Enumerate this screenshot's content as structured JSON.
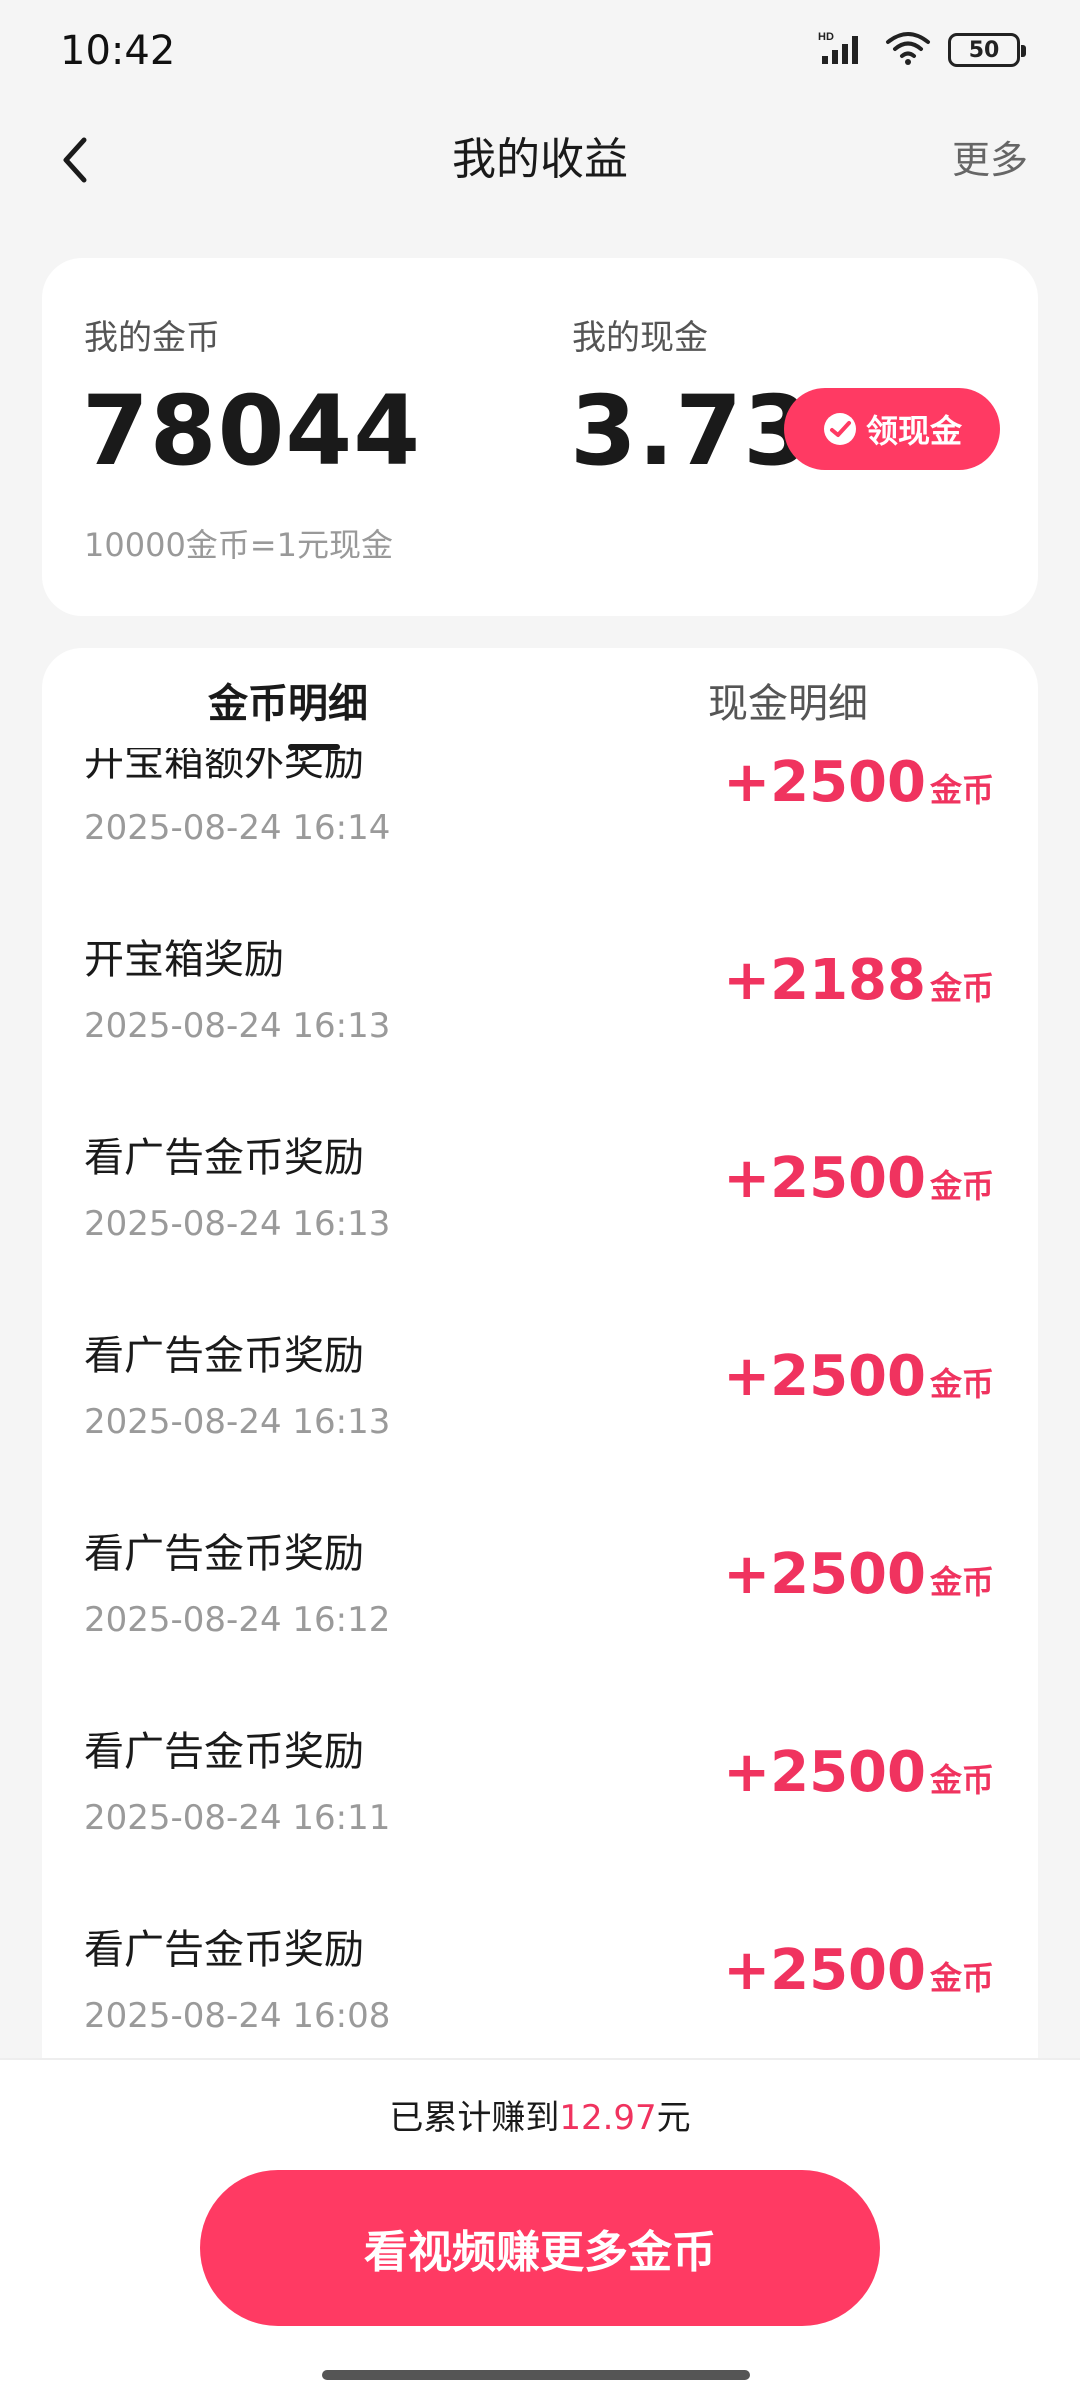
{
  "status_bar": {
    "time": "10:42",
    "network": "HD",
    "battery": "50"
  },
  "nav": {
    "title": "我的收益",
    "more": "更多"
  },
  "summary": {
    "coin_label": "我的金币",
    "coin_value": "78044",
    "cash_label": "我的现金",
    "cash_value": "3.73",
    "withdraw_label": "领现金",
    "rate_text": "10000金币=1元现金"
  },
  "tabs": [
    {
      "label": "金币明细",
      "active": true
    },
    {
      "label": "现金明细",
      "active": false
    }
  ],
  "records": [
    {
      "title": "开宝箱额外奖励",
      "time": "2025-08-24 16:14",
      "amount": "+2500",
      "unit": "金币"
    },
    {
      "title": "开宝箱奖励",
      "time": "2025-08-24 16:13",
      "amount": "+2188",
      "unit": "金币"
    },
    {
      "title": "看广告金币奖励",
      "time": "2025-08-24 16:13",
      "amount": "+2500",
      "unit": "金币"
    },
    {
      "title": "看广告金币奖励",
      "time": "2025-08-24 16:13",
      "amount": "+2500",
      "unit": "金币"
    },
    {
      "title": "看广告金币奖励",
      "time": "2025-08-24 16:12",
      "amount": "+2500",
      "unit": "金币"
    },
    {
      "title": "看广告金币奖励",
      "time": "2025-08-24 16:11",
      "amount": "+2500",
      "unit": "金币"
    },
    {
      "title": "看广告金币奖励",
      "time": "2025-08-24 16:08",
      "amount": "+2500",
      "unit": "金币"
    }
  ],
  "footer": {
    "total_prefix": "已累计赚到",
    "total_amount": "12.97",
    "total_suffix": "元",
    "cta_label": "看视频赚更多金币"
  },
  "colors": {
    "accent": "#ff3a63",
    "amount": "#f0335f",
    "background": "#f5f5f5"
  },
  "icons": {
    "back": "chevron-left-icon",
    "withdraw": "wechat-icon",
    "signal": "signal-icon",
    "wifi": "wifi-icon",
    "battery": "battery-icon"
  }
}
